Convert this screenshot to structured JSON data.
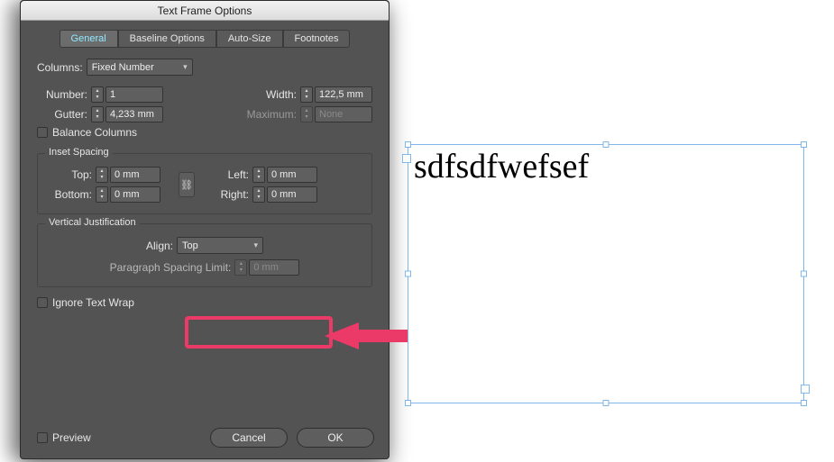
{
  "dialog": {
    "title": "Text Frame Options",
    "tabs": [
      "General",
      "Baseline Options",
      "Auto-Size",
      "Footnotes"
    ],
    "activeTab": 0,
    "columns": {
      "label": "Columns:",
      "mode": "Fixed Number",
      "numberLabel": "Number:",
      "number": "1",
      "gutterLabel": "Gutter:",
      "gutter": "4,233 mm",
      "widthLabel": "Width:",
      "width": "122,5 mm",
      "maximumLabel": "Maximum:",
      "maximum": "None",
      "balanceLabel": "Balance Columns"
    },
    "inset": {
      "legend": "Inset Spacing",
      "topLabel": "Top:",
      "top": "0 mm",
      "bottomLabel": "Bottom:",
      "bottom": "0 mm",
      "leftLabel": "Left:",
      "left": "0 mm",
      "rightLabel": "Right:",
      "right": "0 mm"
    },
    "vjust": {
      "legend": "Vertical Justification",
      "alignLabel": "Align:",
      "align": "Top",
      "paraLimitLabel": "Paragraph Spacing Limit:",
      "paraLimit": "0 mm"
    },
    "ignoreWrapLabel": "Ignore Text Wrap",
    "previewLabel": "Preview",
    "cancel": "Cancel",
    "ok": "OK"
  },
  "canvas": {
    "text": "sdfsdfwefsef"
  },
  "colors": {
    "highlight": "#ec3a68",
    "selection": "#7fb7e8"
  }
}
